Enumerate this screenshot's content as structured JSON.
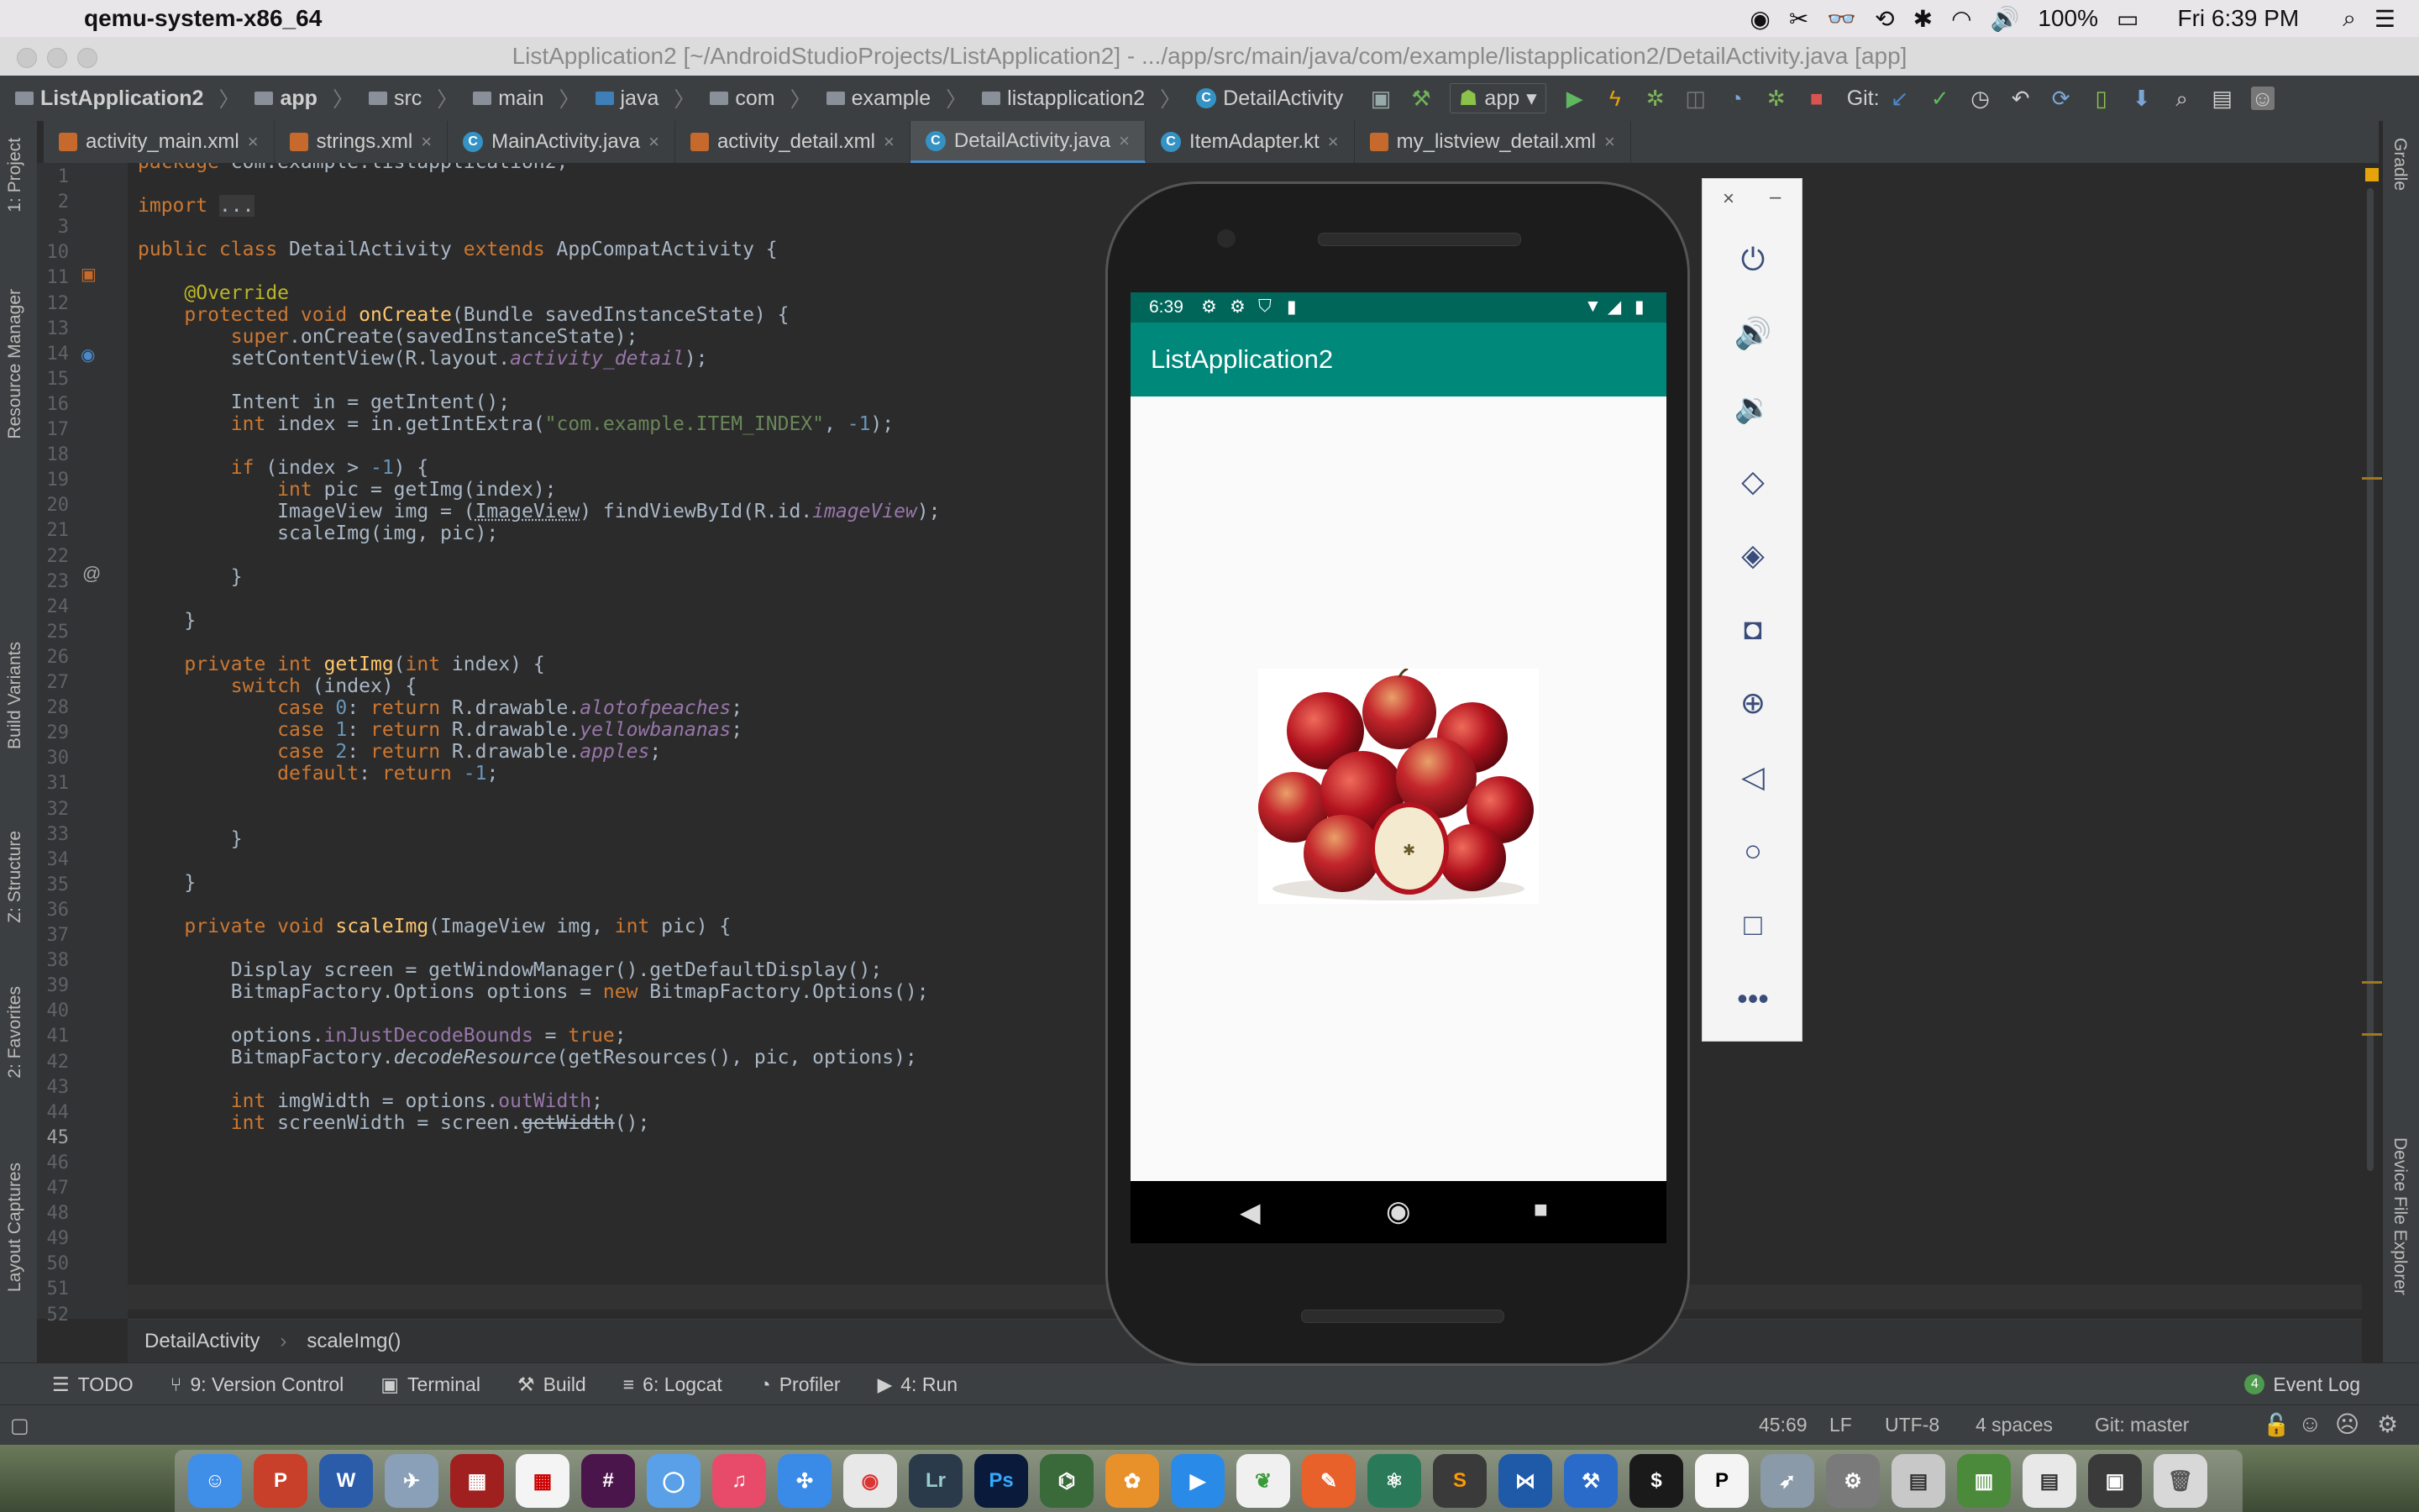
{
  "menubar": {
    "app_name": "qemu-system-x86_64",
    "battery": "100%",
    "clock": "Fri 6:39 PM"
  },
  "window": {
    "title": "ListApplication2 [~/AndroidStudioProjects/ListApplication2] - .../app/src/main/java/com/example/listapplication2/DetailActivity.java [app]"
  },
  "navbar": {
    "crumbs": [
      "ListApplication2",
      "app",
      "src",
      "main",
      "java",
      "com",
      "example",
      "listapplication2",
      "DetailActivity"
    ],
    "run_config": "app",
    "git_label": "Git:"
  },
  "tabs": [
    {
      "label": "activity_main.xml",
      "icon": "xml-file-icon"
    },
    {
      "label": "strings.xml",
      "icon": "xml-file-icon"
    },
    {
      "label": "MainActivity.java",
      "icon": "java-class-icon"
    },
    {
      "label": "activity_detail.xml",
      "icon": "xml-file-icon"
    },
    {
      "label": "DetailActivity.java",
      "icon": "java-class-icon",
      "active": true
    },
    {
      "label": "ItemAdapter.kt",
      "icon": "java-class-icon"
    },
    {
      "label": "my_listview_detail.xml",
      "icon": "xml-file-icon"
    }
  ],
  "left_tools": [
    "1: Project",
    "Resource Manager",
    "Build Variants",
    "Z: Structure",
    "2: Favorites",
    "Layout Captures"
  ],
  "right_tools": [
    "Gradle",
    "Device File Explorer"
  ],
  "editor": {
    "line_numbers": [
      "1",
      "2",
      "3",
      "10",
      "11",
      "12",
      "13",
      "14",
      "15",
      "16",
      "17",
      "18",
      "19",
      "20",
      "21",
      "22",
      "23",
      "24",
      "25",
      "26",
      "27",
      "28",
      "29",
      "30",
      "31",
      "32",
      "33",
      "34",
      "35",
      "36",
      "37",
      "38",
      "39",
      "40",
      "41",
      "42",
      "43",
      "44",
      "45",
      "46",
      "47",
      "48",
      "49",
      "50",
      "51",
      "52"
    ]
  },
  "breadcrumb_bar": {
    "class_name": "DetailActivity",
    "method_name": "scaleImg()"
  },
  "bottom_tools": [
    {
      "label": "TODO",
      "icon": "list-icon"
    },
    {
      "label": "9: Version Control",
      "icon": "vcs-icon"
    },
    {
      "label": "Terminal",
      "icon": "terminal-icon"
    },
    {
      "label": "Build",
      "icon": "hammer-icon"
    },
    {
      "label": "6: Logcat",
      "icon": "logcat-icon"
    },
    {
      "label": "Profiler",
      "icon": "gauge-icon"
    },
    {
      "label": "4: Run",
      "icon": "play-icon"
    }
  ],
  "event_log": {
    "count": "4",
    "label": "Event Log"
  },
  "statusbar": {
    "position": "45:69",
    "line_sep": "LF",
    "encoding": "UTF-8",
    "indent": "4 spaces",
    "git_branch": "Git: master"
  },
  "emulator": {
    "time": "6:39",
    "app_title": "ListApplication2",
    "controls": [
      "power",
      "volume-up",
      "volume-down",
      "rotate-left",
      "rotate-right",
      "screenshot",
      "zoom",
      "back",
      "home",
      "overview",
      "more"
    ]
  },
  "colors": {
    "teal_appbar": "#00897b",
    "teal_statusbar": "#00665a",
    "ide_background": "#2b2b2b"
  }
}
